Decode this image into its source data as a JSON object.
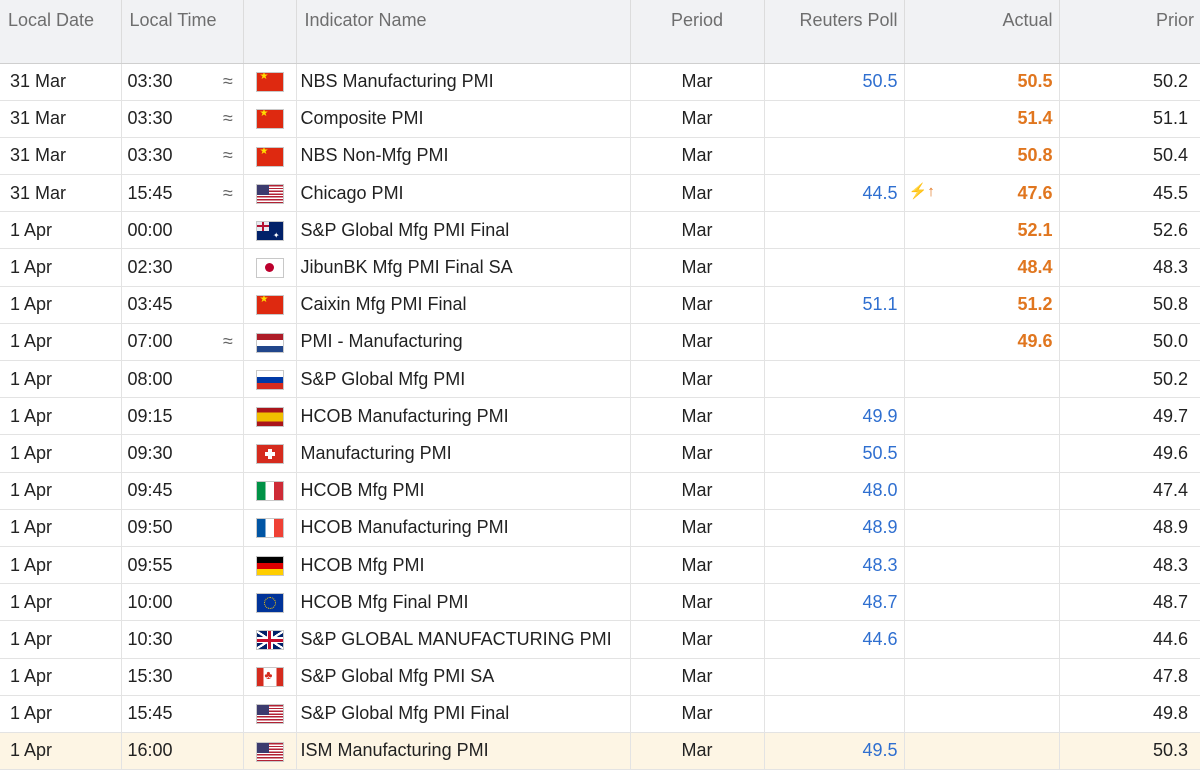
{
  "headers": {
    "date": "Local Date",
    "time": "Local Time",
    "name": "Indicator Name",
    "period": "Period",
    "poll": "Reuters Poll",
    "actual": "Actual",
    "prior": "Prior"
  },
  "colors": {
    "poll_blue": "#2f6fd0",
    "actual_orange": "#e0761f",
    "highlight_row": "#fdf5e4",
    "header_bg": "#f1f2f4"
  },
  "rows": [
    {
      "date": "31 Mar",
      "time": "03:30",
      "indicator": "≈",
      "flag": "cn",
      "name": "NBS Manufacturing PMI",
      "period": "Mar",
      "poll": "50.5",
      "arrow": "",
      "actual": "50.5",
      "prior": "50.2"
    },
    {
      "date": "31 Mar",
      "time": "03:30",
      "indicator": "≈",
      "flag": "cn",
      "name": "Composite PMI",
      "period": "Mar",
      "poll": "",
      "arrow": "",
      "actual": "51.4",
      "prior": "51.1"
    },
    {
      "date": "31 Mar",
      "time": "03:30",
      "indicator": "≈",
      "flag": "cn",
      "name": "NBS Non-Mfg PMI",
      "period": "Mar",
      "poll": "",
      "arrow": "",
      "actual": "50.8",
      "prior": "50.4"
    },
    {
      "date": "31 Mar",
      "time": "15:45",
      "indicator": "≈",
      "flag": "us",
      "name": "Chicago PMI",
      "period": "Mar",
      "poll": "44.5",
      "arrow": "⚡↑",
      "actual": "47.6",
      "prior": "45.5"
    },
    {
      "date": "1 Apr",
      "time": "00:00",
      "indicator": "",
      "flag": "au",
      "name": "S&P Global Mfg PMI Final",
      "period": "Mar",
      "poll": "",
      "arrow": "",
      "actual": "52.1",
      "prior": "52.6"
    },
    {
      "date": "1 Apr",
      "time": "02:30",
      "indicator": "",
      "flag": "jp",
      "name": "JibunBK Mfg PMI Final SA",
      "period": "Mar",
      "poll": "",
      "arrow": "",
      "actual": "48.4",
      "prior": "48.3"
    },
    {
      "date": "1 Apr",
      "time": "03:45",
      "indicator": "",
      "flag": "cn",
      "name": "Caixin Mfg PMI Final",
      "period": "Mar",
      "poll": "51.1",
      "arrow": "",
      "actual": "51.2",
      "prior": "50.8"
    },
    {
      "date": "1 Apr",
      "time": "07:00",
      "indicator": "≈",
      "flag": "nl",
      "name": "PMI - Manufacturing",
      "period": "Mar",
      "poll": "",
      "arrow": "",
      "actual": "49.6",
      "prior": "50.0"
    },
    {
      "date": "1 Apr",
      "time": "08:00",
      "indicator": "",
      "flag": "ru",
      "name": "S&P Global Mfg PMI",
      "period": "Mar",
      "poll": "",
      "arrow": "",
      "actual": "",
      "prior": "50.2"
    },
    {
      "date": "1 Apr",
      "time": "09:15",
      "indicator": "",
      "flag": "es",
      "name": "HCOB Manufacturing PMI",
      "period": "Mar",
      "poll": "49.9",
      "arrow": "",
      "actual": "",
      "prior": "49.7"
    },
    {
      "date": "1 Apr",
      "time": "09:30",
      "indicator": "",
      "flag": "ch",
      "name": "Manufacturing PMI",
      "period": "Mar",
      "poll": "50.5",
      "arrow": "",
      "actual": "",
      "prior": "49.6"
    },
    {
      "date": "1 Apr",
      "time": "09:45",
      "indicator": "",
      "flag": "it",
      "name": "HCOB Mfg PMI",
      "period": "Mar",
      "poll": "48.0",
      "arrow": "",
      "actual": "",
      "prior": "47.4"
    },
    {
      "date": "1 Apr",
      "time": "09:50",
      "indicator": "",
      "flag": "fr",
      "name": "HCOB Manufacturing PMI",
      "period": "Mar",
      "poll": "48.9",
      "arrow": "",
      "actual": "",
      "prior": "48.9"
    },
    {
      "date": "1 Apr",
      "time": "09:55",
      "indicator": "",
      "flag": "de",
      "name": "HCOB Mfg PMI",
      "period": "Mar",
      "poll": "48.3",
      "arrow": "",
      "actual": "",
      "prior": "48.3"
    },
    {
      "date": "1 Apr",
      "time": "10:00",
      "indicator": "",
      "flag": "eu",
      "name": "HCOB Mfg Final PMI",
      "period": "Mar",
      "poll": "48.7",
      "arrow": "",
      "actual": "",
      "prior": "48.7"
    },
    {
      "date": "1 Apr",
      "time": "10:30",
      "indicator": "",
      "flag": "gb",
      "name": "S&P GLOBAL MANUFACTURING PMI",
      "period": "Mar",
      "poll": "44.6",
      "arrow": "",
      "actual": "",
      "prior": "44.6"
    },
    {
      "date": "1 Apr",
      "time": "15:30",
      "indicator": "",
      "flag": "ca",
      "name": "S&P Global Mfg PMI SA",
      "period": "Mar",
      "poll": "",
      "arrow": "",
      "actual": "",
      "prior": "47.8"
    },
    {
      "date": "1 Apr",
      "time": "15:45",
      "indicator": "",
      "flag": "us",
      "name": "S&P Global Mfg PMI Final",
      "period": "Mar",
      "poll": "",
      "arrow": "",
      "actual": "",
      "prior": "49.8"
    },
    {
      "date": "1 Apr",
      "time": "16:00",
      "indicator": "",
      "flag": "us",
      "name": "ISM Manufacturing PMI",
      "period": "Mar",
      "poll": "49.5",
      "arrow": "",
      "actual": "",
      "prior": "50.3",
      "highlighted": true
    }
  ]
}
